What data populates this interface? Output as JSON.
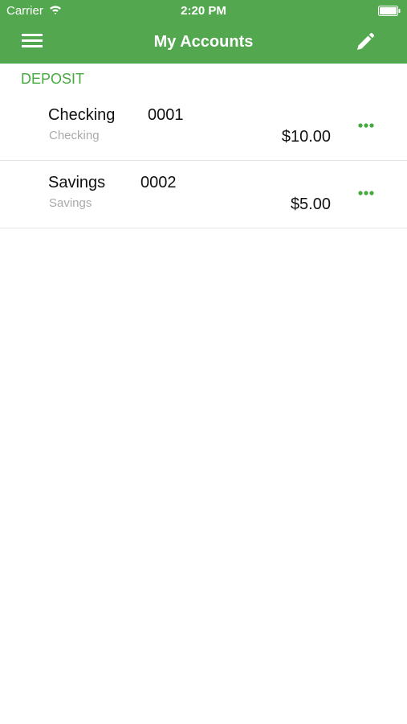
{
  "status_bar": {
    "carrier": "Carrier",
    "time": "2:20 PM"
  },
  "nav_bar": {
    "title": "My Accounts",
    "menu_icon": "hamburger-menu-icon",
    "edit_icon": "pencil-icon"
  },
  "section": {
    "title": "DEPOSIT"
  },
  "accounts": [
    {
      "name": "Checking",
      "number": "0001",
      "type": "Checking",
      "balance": "$10.00",
      "more_icon": "more-options-icon"
    },
    {
      "name": "Savings",
      "number": "0002",
      "type": "Savings",
      "balance": "$5.00",
      "more_icon": "more-options-icon"
    }
  ],
  "colors": {
    "header_background": "#53a84f",
    "accent": "#45a93f",
    "header_text": "#ffffff",
    "secondary_text": "#a9a9a9"
  }
}
